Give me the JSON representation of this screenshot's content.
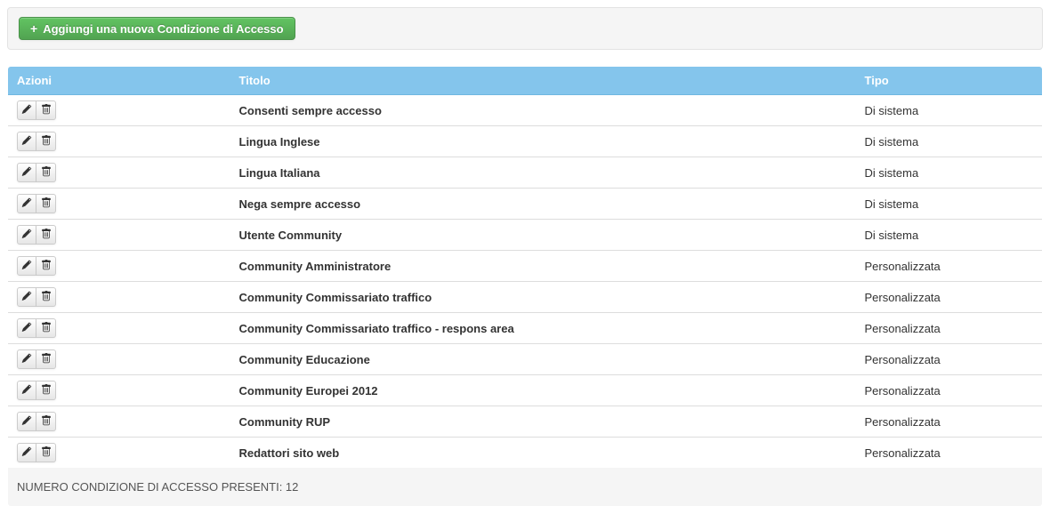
{
  "toolbar": {
    "add_label": "Aggiungi una nuova Condizione di Accesso"
  },
  "table": {
    "headers": {
      "actions": "Azioni",
      "title": "Titolo",
      "type": "Tipo"
    },
    "rows": [
      {
        "title": "Consenti sempre accesso",
        "type": "Di sistema"
      },
      {
        "title": "Lingua Inglese",
        "type": "Di sistema"
      },
      {
        "title": "Lingua Italiana",
        "type": "Di sistema"
      },
      {
        "title": "Nega sempre accesso",
        "type": "Di sistema"
      },
      {
        "title": "Utente Community",
        "type": "Di sistema"
      },
      {
        "title": "Community Amministratore",
        "type": "Personalizzata"
      },
      {
        "title": "Community Commissariato traffico",
        "type": "Personalizzata"
      },
      {
        "title": "Community Commissariato traffico - respons area",
        "type": "Personalizzata"
      },
      {
        "title": "Community Educazione",
        "type": "Personalizzata"
      },
      {
        "title": "Community Europei 2012",
        "type": "Personalizzata"
      },
      {
        "title": "Community RUP",
        "type": "Personalizzata"
      },
      {
        "title": "Redattori sito web",
        "type": "Personalizzata"
      }
    ],
    "footer": "NUMERO CONDIZIONE DI ACCESSO PRESENTI: 12"
  },
  "icons": {
    "edit": "pencil-icon",
    "delete": "trash-icon",
    "plus": "plus-icon"
  }
}
